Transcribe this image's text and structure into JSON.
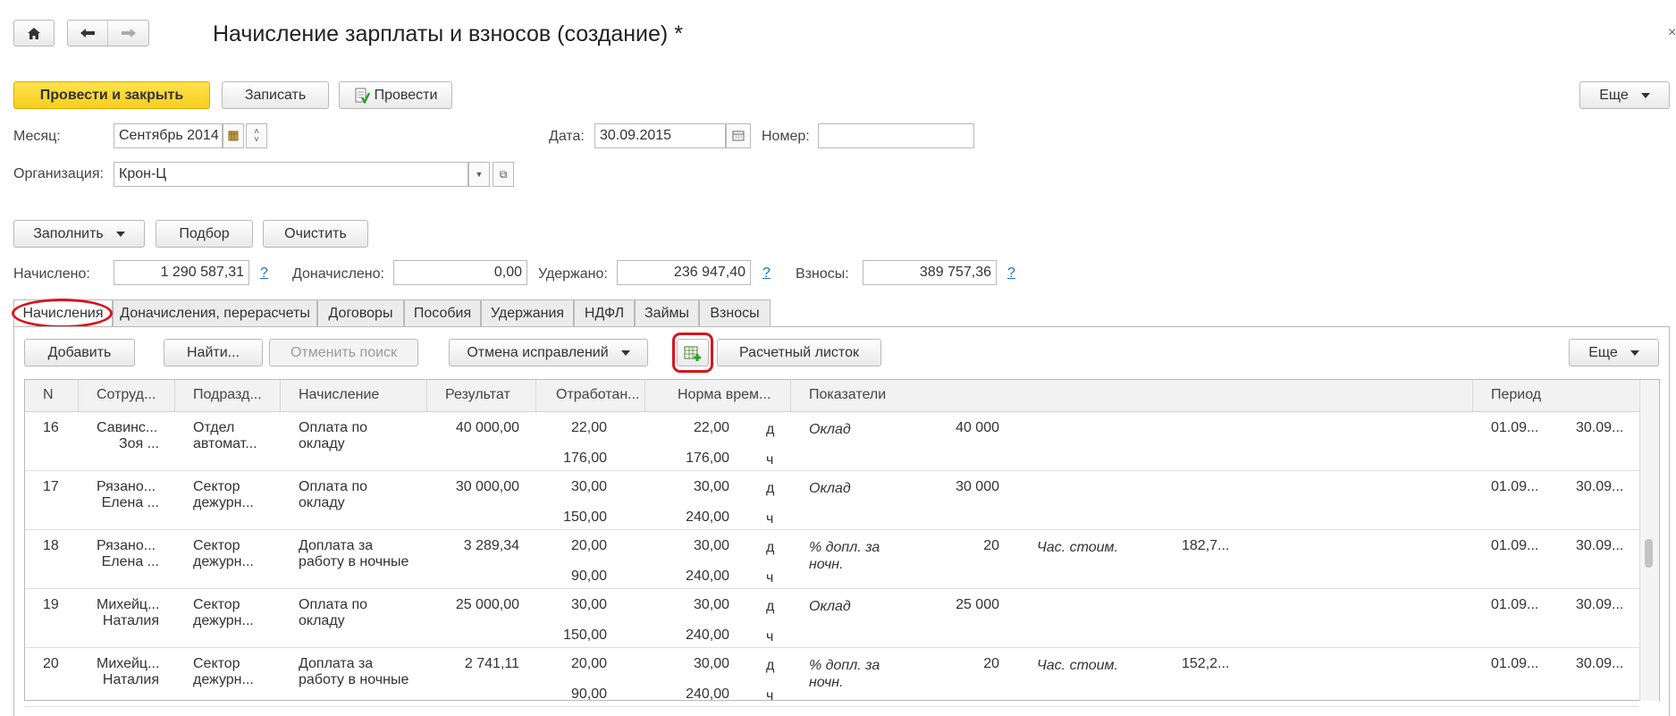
{
  "nav": {
    "home_icon": "home-icon",
    "back_icon": "arrow-left-icon",
    "forward_icon": "arrow-right-icon"
  },
  "title": "Начисление зарплаты и взносов (создание) *",
  "toolbar": {
    "post_close": "Провести и закрыть",
    "save": "Записать",
    "post": "Провести",
    "more": "Еще"
  },
  "form": {
    "month_label": "Месяц:",
    "month_value": "Сентябрь 2014",
    "date_label": "Дата:",
    "date_value": "30.09.2015",
    "number_label": "Номер:",
    "number_value": "",
    "org_label": "Организация:",
    "org_value": "Крон-Ц"
  },
  "actions": {
    "fill": "Заполнить",
    "select": "Подбор",
    "clear": "Очистить"
  },
  "totals": {
    "accrued_label": "Начислено:",
    "accrued": "1 290 587,31",
    "extra_label": "Доначислено:",
    "extra": "0,00",
    "withheld_label": "Удержано:",
    "withheld": "236 947,40",
    "contrib_label": "Взносы:",
    "contrib": "389 757,36",
    "help": "?"
  },
  "tabs": [
    "Начисления",
    "Доначисления, перерасчеты",
    "Договоры",
    "Пособия",
    "Удержания",
    "НДФЛ",
    "Займы",
    "Взносы"
  ],
  "table_toolbar": {
    "add": "Добавить",
    "find": "Найти...",
    "cancel_search": "Отменить поиск",
    "cancel_fix": "Отмена исправлений",
    "payslip": "Расчетный листок",
    "more": "Еще"
  },
  "columns": [
    "N",
    "Сотруд...",
    "Подразд...",
    "Начисление",
    "Результат",
    "Отработан...",
    "Норма врем...",
    "Показатели",
    "Период"
  ],
  "rows": [
    {
      "n": "16",
      "emp1": "Савинс...",
      "emp2": "Зоя ...",
      "dep1": "Отдел",
      "dep2": "автомат...",
      "acc1": "Оплата по",
      "acc2": "окладу",
      "result": "40 000,00",
      "worked1": "22,00",
      "worked2": "176,00",
      "norm1": "22,00",
      "norm2": "176,00",
      "u1": "д",
      "u2": "ч",
      "ind1": "Оклад",
      "ind2": "",
      "ind_val": "40 000",
      "ind_b": "",
      "ind_b_val": "",
      "per1": "01.09...",
      "per2": "30.09..."
    },
    {
      "n": "17",
      "emp1": "Рязано...",
      "emp2": "Елена ...",
      "dep1": "Сектор",
      "dep2": "дежурн...",
      "acc1": "Оплата по",
      "acc2": "окладу",
      "result": "30 000,00",
      "worked1": "30,00",
      "worked2": "150,00",
      "norm1": "30,00",
      "norm2": "240,00",
      "u1": "д",
      "u2": "ч",
      "ind1": "Оклад",
      "ind2": "",
      "ind_val": "30 000",
      "ind_b": "",
      "ind_b_val": "",
      "per1": "01.09...",
      "per2": "30.09..."
    },
    {
      "n": "18",
      "emp1": "Рязано...",
      "emp2": "Елена ...",
      "dep1": "Сектор",
      "dep2": "дежурн...",
      "acc1": "Доплата за",
      "acc2": "работу в ночные",
      "result": "3 289,34",
      "worked1": "20,00",
      "worked2": "90,00",
      "norm1": "30,00",
      "norm2": "240,00",
      "u1": "д",
      "u2": "ч",
      "ind1": "% допл. за",
      "ind2": "ночн.",
      "ind_val": "20",
      "ind_b": "Час. стоим.",
      "ind_b_val": "182,7...",
      "per1": "01.09...",
      "per2": "30.09..."
    },
    {
      "n": "19",
      "emp1": "Михейц...",
      "emp2": "Наталия",
      "dep1": "Сектор",
      "dep2": "дежурн...",
      "acc1": "Оплата по",
      "acc2": "окладу",
      "result": "25 000,00",
      "worked1": "30,00",
      "worked2": "150,00",
      "norm1": "30,00",
      "norm2": "240,00",
      "u1": "д",
      "u2": "ч",
      "ind1": "Оклад",
      "ind2": "",
      "ind_val": "25 000",
      "ind_b": "",
      "ind_b_val": "",
      "per1": "01.09...",
      "per2": "30.09..."
    },
    {
      "n": "20",
      "emp1": "Михейц...",
      "emp2": "Наталия",
      "dep1": "Сектор",
      "dep2": "дежурн...",
      "acc1": "Доплата за",
      "acc2": "работу в ночные",
      "result": "2 741,11",
      "worked1": "20,00",
      "worked2": "90,00",
      "norm1": "30,00",
      "norm2": "240,00",
      "u1": "д",
      "u2": "ч",
      "ind1": "% допл. за",
      "ind2": "ночн.",
      "ind_val": "20",
      "ind_b": "Час. стоим.",
      "ind_b_val": "152,2...",
      "per1": "01.09...",
      "per2": "30.09..."
    }
  ],
  "colors": {
    "highlight": "#d8141c",
    "accent_yellow": "#f7cf1f",
    "link": "#1e6fbf"
  }
}
